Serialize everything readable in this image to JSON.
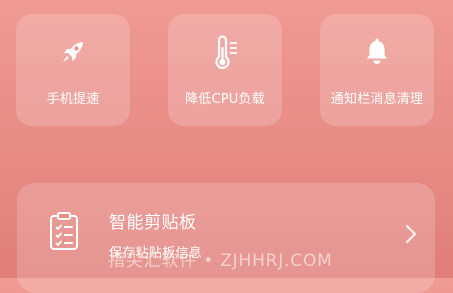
{
  "tiles": [
    {
      "label": "手机提速",
      "icon": "rocket-icon"
    },
    {
      "label": "降低CPU负载",
      "icon": "thermometer-icon"
    },
    {
      "label": "通知栏消息清理",
      "icon": "bell-icon"
    }
  ],
  "card": {
    "title": "智能剪贴板",
    "subtitle": "保存粘贴板信息",
    "icon": "clipboard-icon",
    "chevron": "chevron-right-icon"
  },
  "watermark": "指尖汇软件 • ZJHHRJ.COM",
  "colors": {
    "background_top": "#ef9a93",
    "background_bottom": "#e07e79",
    "tile_fill": "rgba(255,255,255,0.18)",
    "text": "#ffffff"
  }
}
